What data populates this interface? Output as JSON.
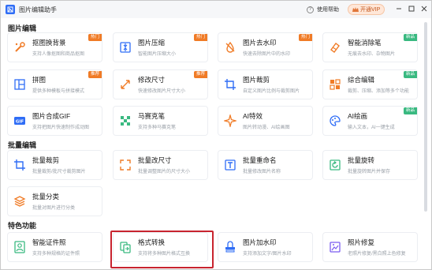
{
  "app": {
    "title": "图片编辑助手"
  },
  "header": {
    "help_label": "使用帮助",
    "vip_label": "开通VIP"
  },
  "colors": {
    "accent": "#2f6df6",
    "hot_badge": "#f07b26",
    "new_badge": "#39b980",
    "highlight": "#c8242f"
  },
  "sections": {
    "s1": {
      "title": "图片编辑"
    },
    "s2": {
      "title": "批量编辑"
    },
    "s3": {
      "title": "特色功能"
    }
  },
  "cards": [
    {
      "name": "抠图换背景",
      "desc": "支持人像抠图和商品抠图",
      "badge": "热门",
      "icon": "cutout-icon"
    },
    {
      "name": "图片压缩",
      "desc": "智能图片压缩大小",
      "badge": "热门",
      "icon": "compress-icon"
    },
    {
      "name": "图片去水印",
      "desc": "快速去除图片中的水印",
      "badge": "热门",
      "icon": "remove-watermark-icon"
    },
    {
      "name": "智能消除笔",
      "desc": "无痕去水印、杂物图片",
      "badge": "新品",
      "icon": "eraser-icon"
    },
    {
      "name": "拼图",
      "desc": "提供多种模板与拼接模式",
      "badge": "推荐",
      "icon": "collage-icon"
    },
    {
      "name": "修改尺寸",
      "desc": "快速修改图片尺寸大小",
      "badge": "推荐",
      "icon": "resize-icon"
    },
    {
      "name": "图片裁剪",
      "desc": "自定义图片比例与裁剪图片",
      "badge": "",
      "icon": "crop-icon"
    },
    {
      "name": "综合编辑",
      "desc": "裁剪、压缩、添加等多个功能",
      "badge": "新品",
      "icon": "edit-icon"
    },
    {
      "name": "图片合成GIF",
      "desc": "支持把图片快速制作成动图",
      "badge": "",
      "icon": "gif-icon"
    },
    {
      "name": "马赛克笔",
      "desc": "支持多种马赛克笔",
      "badge": "",
      "icon": "mosaic-icon"
    },
    {
      "name": "AI特效",
      "desc": "图片转动漫、AI绘画图",
      "badge": "",
      "icon": "ai-effect-icon"
    },
    {
      "name": "AI绘画",
      "desc": "输入文本，AI一键生成",
      "badge": "新品",
      "icon": "ai-paint-icon"
    },
    {
      "name": "批量裁剪",
      "desc": "批量裁剪/批尺寸裁剪图片",
      "badge": "",
      "icon": "batch-crop-icon"
    },
    {
      "name": "批量改尺寸",
      "desc": "批量调整图片的尺寸大小",
      "badge": "",
      "icon": "batch-resize-icon"
    },
    {
      "name": "批量重命名",
      "desc": "批量修改图片名称",
      "badge": "",
      "icon": "batch-rename-icon"
    },
    {
      "name": "批量旋转",
      "desc": "批量旋转图片并保存",
      "badge": "",
      "icon": "batch-rotate-icon"
    },
    {
      "name": "批量分类",
      "desc": "批量对图片进行分类",
      "badge": "",
      "icon": "batch-sort-icon"
    },
    {
      "name": "智能证件照",
      "desc": "支持多种规格的证件照",
      "badge": "",
      "icon": "id-photo-icon"
    },
    {
      "name": "格式转换",
      "desc": "支持将多种图片格式互换",
      "badge": "",
      "icon": "convert-icon"
    },
    {
      "name": "图片加水印",
      "desc": "支持添加文字/图片水印",
      "badge": "",
      "icon": "add-watermark-icon"
    },
    {
      "name": "照片修复",
      "desc": "老照片修复/黑白照上色修复",
      "badge": "",
      "icon": "repair-icon"
    }
  ]
}
